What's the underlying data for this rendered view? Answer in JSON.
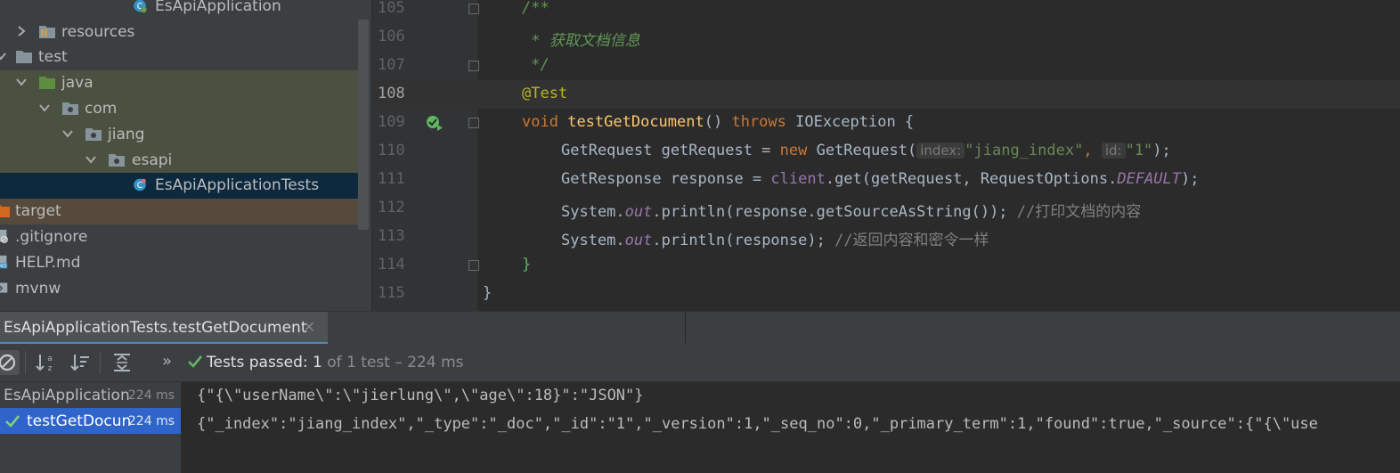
{
  "project_tree": {
    "items": [
      {
        "label": "EsApiApplication"
      },
      {
        "label": "resources"
      },
      {
        "label": "test"
      },
      {
        "label": "java"
      },
      {
        "label": "com"
      },
      {
        "label": "jiang"
      },
      {
        "label": "esapi"
      },
      {
        "label": "EsApiApplicationTests"
      },
      {
        "label": "target"
      },
      {
        "label": ".gitignore"
      },
      {
        "label": "HELP.md"
      },
      {
        "label": "mvnw"
      }
    ]
  },
  "editor": {
    "line_numbers": [
      "105",
      "106",
      "107",
      "108",
      "109",
      "110",
      "111",
      "112",
      "113",
      "114",
      "115"
    ],
    "lines": {
      "l105": "/**",
      "l106": " * 获取文档信息",
      "l107": " */",
      "l108_ann": "@Test",
      "l109": {
        "void": "void",
        "name": "testGetDocument",
        "paren": "() ",
        "throws": "throws",
        "ex": " IOException {"
      },
      "l110": {
        "pre": "GetRequest getRequest = ",
        "new": "new",
        "cls": " GetRequest(",
        "hint1": "index:",
        "str1": "\"jiang_index\"",
        "comma": ", ",
        "hint2": "id:",
        "str2": "\"1\"",
        "end": ");"
      },
      "l111": {
        "pre": "GetResponse response = ",
        "client": "client",
        "mid": ".get(getRequest, RequestOptions.",
        "def": "DEFAULT",
        "end": ");"
      },
      "l112": {
        "pre": "System.",
        "out": "out",
        "mid": ".println(response.getSourceAsString()); ",
        "cmt": "//打印文档的内容"
      },
      "l113": {
        "pre": "System.",
        "out": "out",
        "mid": ".println(response); ",
        "cmt": "//返回内容和密令一样"
      },
      "l114": "}",
      "l115": "}"
    }
  },
  "run_panel": {
    "tab_label": "EsApiApplicationTests.testGetDocument",
    "tab_close": "×",
    "status": {
      "label": "Tests passed:",
      "passed": "1",
      "rest": "of 1 test – 224 ms"
    },
    "more": "»",
    "tests": [
      {
        "name": "EsApiApplication",
        "time": "224 ms"
      },
      {
        "name": "testGetDocun",
        "time": "224 ms"
      }
    ],
    "console_lines": [
      "{\"{\\\"userName\\\":\\\"jierlung\\\",\\\"age\\\":18}\":\"JSON\"}",
      "{\"_index\":\"jiang_index\",\"_type\":\"_doc\",\"_id\":\"1\",\"_version\":1,\"_seq_no\":0,\"_primary_term\":1,\"found\":true,\"_source\":{\"{\\\"use"
    ]
  },
  "colors": {
    "selection_blue": "#2f65ca",
    "pass_green": "#5fb760",
    "folder_green": "#5e8f3e",
    "folder_gray": "#87939a"
  }
}
